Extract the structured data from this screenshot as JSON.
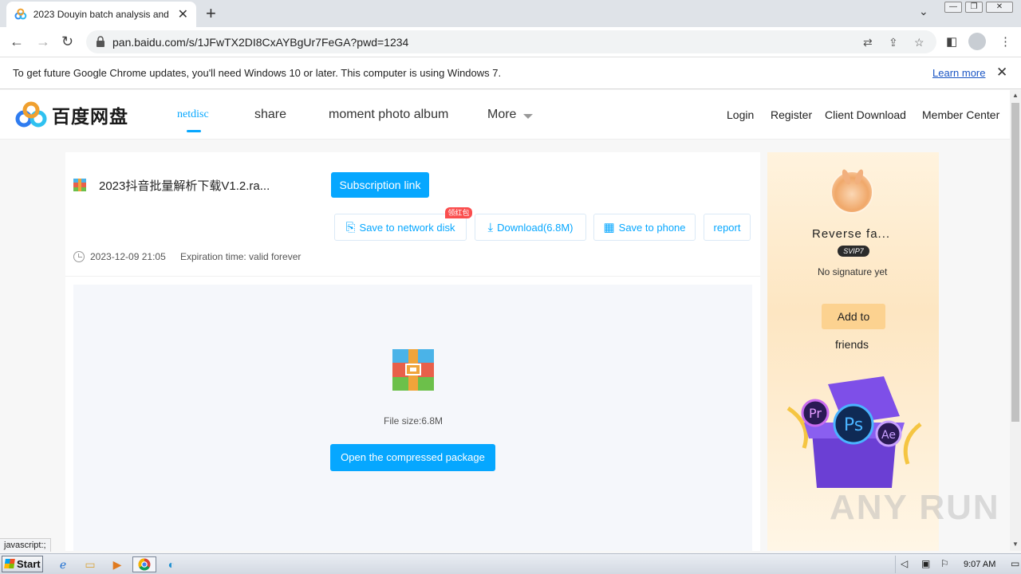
{
  "browser": {
    "tab_title": "2023 Douyin batch analysis and dow",
    "tab_close": "✕",
    "new_tab": "+",
    "url": "pan.baidu.com/s/1JFwTX2DI8CxAYBgUr7FeGA?pwd=1234",
    "window_controls": [
      "—",
      "❐",
      "✕"
    ]
  },
  "infobar": {
    "message": "To get future Google Chrome updates, you'll need Windows 10 or later. This computer is using Windows 7.",
    "learn_more": "Learn more",
    "close": "✕"
  },
  "site": {
    "logo_text": "百度网盘",
    "nav": [
      "netdisc",
      "share",
      "moment photo album",
      "More"
    ],
    "right_links": [
      "Login",
      "Register",
      "Client Download",
      "Member Center"
    ]
  },
  "file": {
    "name": "2023抖音批量解析下载V1.2.ra...",
    "subscription_label": "Subscription link",
    "hongbao": "领红包",
    "actions": {
      "save_network": "Save to network disk",
      "download": "Download(6.8M)",
      "save_phone": "Save to phone",
      "report": "report"
    },
    "date": "2023-12-09 21:05",
    "expiration": "Expiration time: valid forever",
    "size": "File size:6.8M",
    "open_label": "Open the compressed package"
  },
  "profile": {
    "name": "Reverse fa...",
    "vip": "SVIP7",
    "signature": "No signature yet",
    "add_label": "Add to",
    "friends_label": "friends",
    "gift_labels": [
      "Pr",
      "Ps",
      "Ae"
    ]
  },
  "status_text": "javascript:;",
  "watermark": "ANY RUN",
  "taskbar": {
    "start": "Start",
    "time": "9:07 AM"
  },
  "colors": {
    "accent": "#06a7ff",
    "vip_gold": "#fcd290",
    "hongbao_red": "#fa4e4e"
  }
}
